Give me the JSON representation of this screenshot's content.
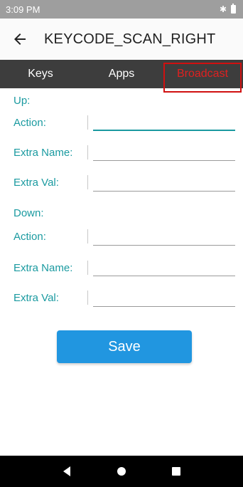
{
  "status_bar": {
    "time": "3:09 PM",
    "icons": [
      "bluetooth-icon",
      "battery-icon"
    ]
  },
  "app_bar": {
    "title": "KEYCODE_SCAN_RIGHT",
    "back_icon": "arrow-left-icon"
  },
  "tabs": [
    {
      "label": "Keys",
      "active": false
    },
    {
      "label": "Apps",
      "active": false
    },
    {
      "label": "Broadcast",
      "active": true
    }
  ],
  "form": {
    "up": {
      "title": "Up:",
      "action_label": "Action:",
      "action_value": "",
      "extra_name_label": "Extra Name:",
      "extra_name_value": "",
      "extra_val_label": "Extra Val:",
      "extra_val_value": ""
    },
    "down": {
      "title": "Down:",
      "action_label": "Action:",
      "action_value": "",
      "extra_name_label": "Extra Name:",
      "extra_name_value": "",
      "extra_val_label": "Extra Val:",
      "extra_val_value": ""
    }
  },
  "save_label": "Save",
  "colors": {
    "accent": "#1a9aa0",
    "tab_bar": "#3d3d3d",
    "active_tab": "#e02020",
    "save_button": "#2196e0"
  },
  "nav_bar": {
    "icons": [
      "nav-back-icon",
      "nav-home-icon",
      "nav-recents-icon"
    ]
  }
}
